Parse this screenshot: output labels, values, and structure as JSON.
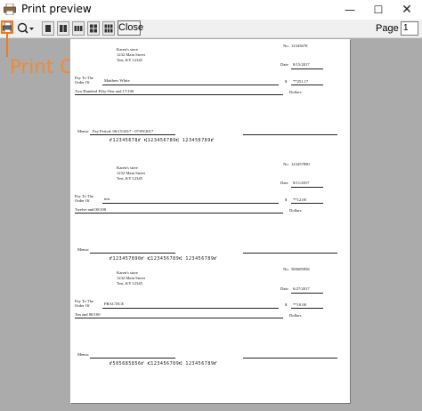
{
  "window": {
    "title": "Print preview"
  },
  "toolbar": {
    "close_label": "Close",
    "page_label": "Page",
    "page_value": "1"
  },
  "annotation": {
    "text": "Print Checks",
    "color": "#f07a1e"
  },
  "colors": {
    "canvas": "#ababab",
    "highlight": "#f07a1e"
  },
  "icons": [
    "printer-icon",
    "zoom-icon",
    "dropdown-arrow-icon",
    "one-page-icon",
    "two-page-icon",
    "three-page-icon",
    "four-page-icon",
    "six-page-icon",
    "minimize-icon",
    "maximize-icon",
    "close-window-icon"
  ],
  "checks": [
    {
      "check_no_label": "No.",
      "check_no": "12345678",
      "company": [
        "Karen's store",
        "1232 Main Street",
        "Test, KY 12345"
      ],
      "date_label": "Date",
      "date": "8/15/2017",
      "payto_label": [
        "Pay To The",
        "Order Of"
      ],
      "payee": "Matthew White",
      "currency": "$",
      "amount": "**251.17",
      "amount_words": "Two Hundred Fifty-One and 17/100",
      "dollars_label": "Dollars",
      "memo_label": "Memo:",
      "memo": "Pay Period: 06/15/2017 - 07/09/2017",
      "micr": "⑈12345678⑈ ⑆123456789⑆ 123456789⑈"
    },
    {
      "check_no_label": "No.",
      "check_no": "123457890",
      "company": [
        "Karen's store",
        "1232 Main Street",
        "Test, KY 12345"
      ],
      "date_label": "Date",
      "date": "8/11/2017",
      "payto_label": [
        "Pay To The",
        "Order Of"
      ],
      "payee": "test",
      "currency": "$",
      "amount": "**12.00",
      "amount_words": "Twelve and 00/100",
      "dollars_label": "Dollars",
      "memo_label": "Memo:",
      "memo": "",
      "micr": "⑈123457890⑈ ⑆123456789⑆ 123456789⑈"
    },
    {
      "check_no_label": "No.",
      "check_no": "585685856",
      "company": [
        "Karen's store",
        "1232 Main Street",
        "Test, KY 12345"
      ],
      "date_label": "Date",
      "date": "6/27/2017",
      "payto_label": [
        "Pay To The",
        "Order Of"
      ],
      "payee": "PRACTICE",
      "currency": "$",
      "amount": "**10.00",
      "amount_words": "Ten and 00/100",
      "dollars_label": "Dollars",
      "memo_label": "Memo:",
      "memo": "",
      "micr": "⑈585685856⑈ ⑆123456789⑆ 123456789⑈"
    }
  ]
}
